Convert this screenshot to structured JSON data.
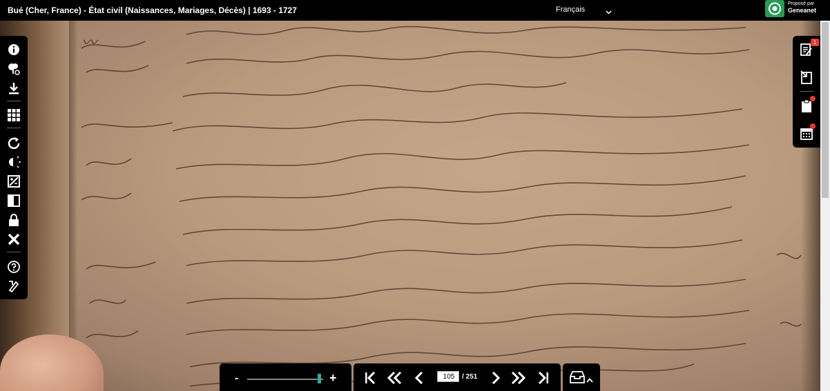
{
  "header": {
    "title": "Bué (Cher, France) - État civil (Naissances, Mariages, Décès) | 1693 - 1727",
    "language": "Français",
    "sponsor_top": "Proposé par",
    "sponsor_name": "Geneanet"
  },
  "left_toolbar": {
    "items": [
      "info-icon",
      "family-tree-icon",
      "download-icon",
      "grid-icon",
      "rotate-icon",
      "brightness-icon",
      "contrast-adjust-icon",
      "invert-icon",
      "lock-icon",
      "close-icon",
      "help-icon",
      "tools-icon"
    ]
  },
  "right_toolbar": {
    "notes_badge": "1",
    "items": [
      "notes-icon",
      "export-note-icon",
      "clipboard-icon",
      "calendar-icon"
    ]
  },
  "navigation": {
    "current_page": "105",
    "total_pages": "/ 251",
    "zoom_minus": "-",
    "zoom_plus": "+",
    "zoom_level": 0.95
  },
  "colors": {
    "toolbar_bg": "#000000",
    "accent": "#3aa59a",
    "badge": "#e53935",
    "sponsor": "#2a9a56"
  }
}
